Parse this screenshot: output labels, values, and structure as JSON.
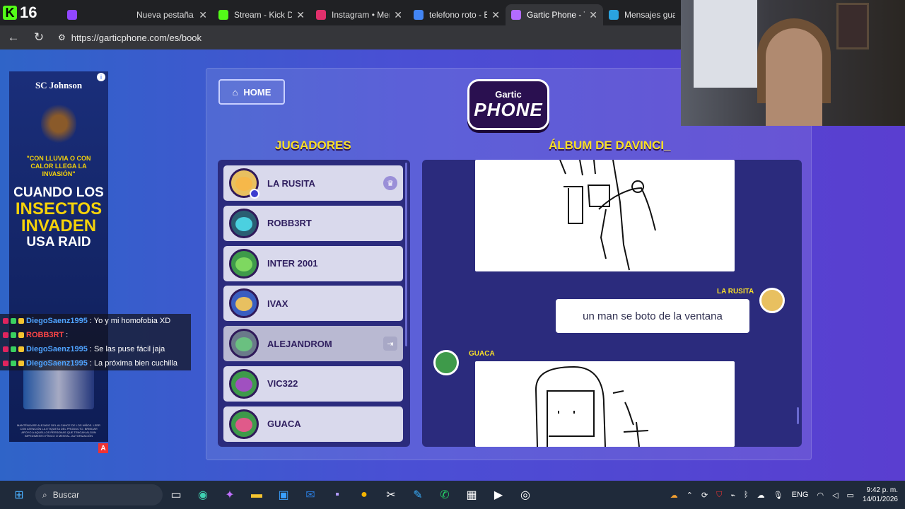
{
  "browser": {
    "live_count": "16",
    "tabs": [
      {
        "title": "",
        "icon": "twitch-icon",
        "color": "#9146ff"
      },
      {
        "title": "Nueva pestaña",
        "icon": "blank-tab-icon",
        "color": "#202124"
      },
      {
        "title": "Stream - Kick Dash",
        "icon": "kick-icon",
        "color": "#53fc18"
      },
      {
        "title": "Instagram • Mensa",
        "icon": "instagram-icon",
        "color": "#e1306c"
      },
      {
        "title": "telefono roto - Bús",
        "icon": "search-icon",
        "color": "#4285f4"
      },
      {
        "title": "Gartic Phone - Tele",
        "icon": "phone-icon",
        "color": "#b36bff"
      },
      {
        "title": "Mensajes guardad",
        "icon": "telegram-icon",
        "color": "#2aa3e0"
      }
    ],
    "url": "https://garticphone.com/es/book"
  },
  "ad": {
    "brand": "SC Johnson",
    "yellow_text": "\"CON LLUVIA O CON CALOR LLEGA LA INVASIÓN\"",
    "headline_1": "CUANDO LOS",
    "headline_2": "INSECTOS",
    "headline_3": "INVADEN",
    "headline_4": "USA RAID",
    "fine_print": "MANTÉNGASE ALEJADO DEL ALCANCE DE LOS NIÑOS. LEER CON ATENCIÓN LA ETIQUETA DEL PRODUCTO. BRINDAR APOYO A AQUELLOS PERSONAS QUE TENGAN ALGÚN IMPEDIMENTO FÍSICO O MENTAL. AUTORIZACIÓN",
    "ad_marker": "A"
  },
  "chat": [
    {
      "user": "DiegoSaenz1995",
      "msg": ": Yo y mi homofobia XD",
      "color": "blue"
    },
    {
      "user": "ROBB3RT",
      "msg": ":",
      "color": "red"
    },
    {
      "user": "DiegoSaenz1995",
      "msg": ": Se las puse fácil jaja",
      "color": "blue"
    },
    {
      "user": "DiegoSaenz1995",
      "msg": ": La próxima bien cuchilla",
      "color": "blue"
    }
  ],
  "game": {
    "home_label": "HOME",
    "logo_top": "Gartic",
    "logo_main": "PHONE",
    "players_title": "JUGADORES",
    "album_title": "ÁLBUM DE DAVINCI_",
    "players": [
      {
        "name": "LA RUSITA",
        "host": true,
        "avatar_color": "#e8c060",
        "face_color": "#f6b84a"
      },
      {
        "name": "ROBB3RT",
        "host": false,
        "avatar_color": "#2a5e72",
        "face_color": "#4bd0e0"
      },
      {
        "name": "INTER 2001",
        "host": false,
        "avatar_color": "#3e9a4a",
        "face_color": "#7ed860"
      },
      {
        "name": "IVAX",
        "host": false,
        "avatar_color": "#3a5ec0",
        "face_color": "#e8c060"
      },
      {
        "name": "ALEJANDROM",
        "host": false,
        "avatar_color": "#6a7a8a",
        "face_color": "#6ac080",
        "disconnected": true
      },
      {
        "name": "VIC322",
        "host": false,
        "avatar_color": "#3e9a4a",
        "face_color": "#a050c0"
      },
      {
        "name": "GUACA",
        "host": false,
        "avatar_color": "#3e9a4a",
        "face_color": "#e05a8a"
      }
    ],
    "album": {
      "entry_1_author": "LA RUSITA",
      "entry_1_text": "un man se boto de la ventana",
      "entry_2_author": "GUACA"
    }
  },
  "taskbar": {
    "search_label": "Buscar",
    "language": "ENG",
    "time": "9:42 p. m.",
    "date": "14/01/2026"
  }
}
